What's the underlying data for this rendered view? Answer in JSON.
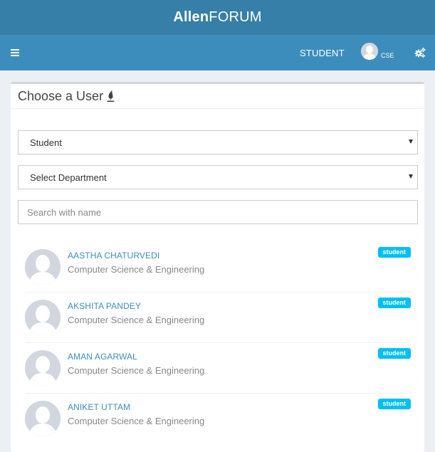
{
  "app": {
    "title_bold": "Allen",
    "title_rest": "FORUM"
  },
  "navbar": {
    "role": "STUDENT",
    "dept": "CSE",
    "menu_icon": "hamburger-icon",
    "settings_icon": "cogs-icon"
  },
  "card": {
    "title": "Choose a User",
    "title_icon": "pen-icon"
  },
  "filters": {
    "role_selected": "Student",
    "department_selected": "Select Department",
    "search_placeholder": "Search with name"
  },
  "users": [
    {
      "name": "AASTHA CHATURVEDI",
      "dept": "Computer Science & Engineering",
      "badge": "student"
    },
    {
      "name": "AKSHITA PANDEY",
      "dept": "Computer Science & Engineering",
      "badge": "student"
    },
    {
      "name": "AMAN AGARWAL",
      "dept": "Computer Science & Engineering",
      "badge": "student"
    },
    {
      "name": "ANIKET UTTAM",
      "dept": "Computer Science & Engineering",
      "badge": "student"
    }
  ],
  "colors": {
    "header": "#367fa9",
    "navbar": "#3c8dbc",
    "badge": "#00c0ef",
    "link": "#3c8dbc"
  }
}
